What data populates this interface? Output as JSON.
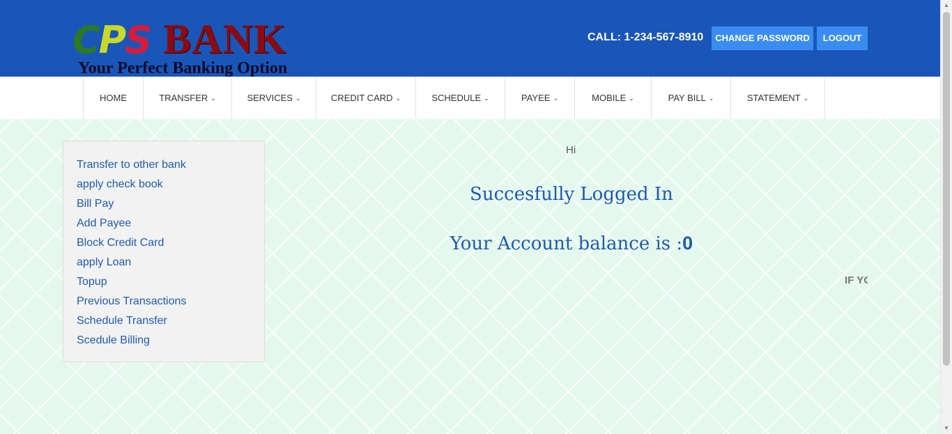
{
  "header": {
    "logo": {
      "brand_initials": [
        "C",
        "P",
        "S"
      ],
      "brand_name": "BANK",
      "tagline": "Your Perfect Banking Option"
    },
    "call_text": "CALL: 1-234-567-8910",
    "change_password_label": "CHANGE PASSWORD",
    "logout_label": "LOGOUT"
  },
  "nav": {
    "items": [
      {
        "label": "HOME",
        "dropdown": false
      },
      {
        "label": "TRANSFER",
        "dropdown": true
      },
      {
        "label": "SERVICES",
        "dropdown": true
      },
      {
        "label": "CREDIT CARD",
        "dropdown": true
      },
      {
        "label": "SCHEDULE",
        "dropdown": true
      },
      {
        "label": "PAYEE",
        "dropdown": true
      },
      {
        "label": "MOBILE",
        "dropdown": true
      },
      {
        "label": "PAY BILL",
        "dropdown": true
      },
      {
        "label": "STATEMENT",
        "dropdown": true
      }
    ]
  },
  "sidebar": {
    "links": [
      "Transfer to other bank",
      "apply check book",
      "Bill Pay",
      "Add Payee",
      "Block Credit Card",
      "apply Loan",
      "Topup",
      "Previous Transactions",
      "Schedule Transfer",
      "Scedule Billing"
    ]
  },
  "main": {
    "greeting": "Hi",
    "success_message": "Succesfully Logged In",
    "balance_label": "Your Account balance is :",
    "balance_value": "0",
    "marquee_text": "IF YO"
  },
  "colors": {
    "header_bg": "#1a56b8",
    "button_bg": "#3a8cf0",
    "link": "#1f5ab0",
    "content_bg": "#e4f8ee"
  },
  "icons": {
    "dropdown": "chevron-down-icon"
  }
}
